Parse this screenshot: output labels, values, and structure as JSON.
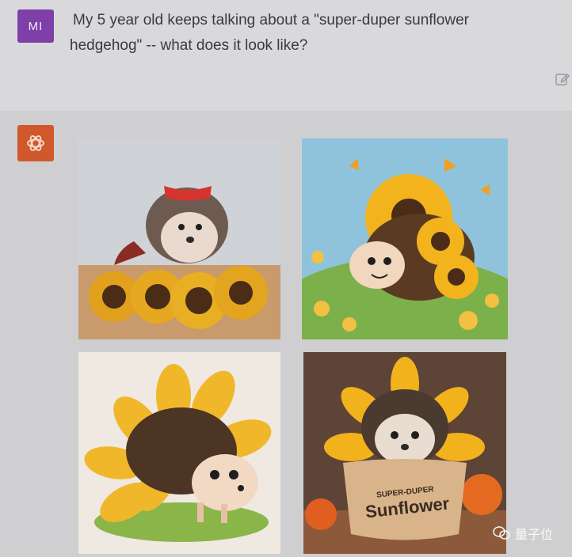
{
  "user": {
    "avatar_initials": "MI",
    "message": "My 5 year old keeps talking about a \"super-duper sunflower hedgehog\" -- what does it look like?"
  },
  "assistant": {
    "avatar_icon": "openai-logo-icon",
    "images": [
      {
        "description_icon": "hedgehog-with-mask-on-sunflowers"
      },
      {
        "description_icon": "cartoon-hedgehog-in-meadow"
      },
      {
        "description_icon": "cartoon-hedgehog-sunflower-spikes"
      },
      {
        "description_icon": "hedgehog-in-sunflower-pot",
        "pot_text_line1": "SUPER-DUPER",
        "pot_text_line2": "Sunflower"
      }
    ]
  },
  "watermark": {
    "text": "量子位"
  },
  "colors": {
    "user_avatar": "#7e3fa8",
    "assistant_avatar": "#d0582a"
  }
}
